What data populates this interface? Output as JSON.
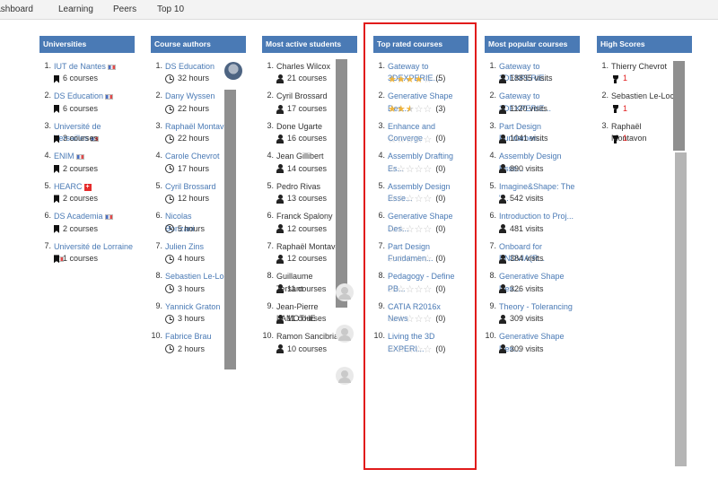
{
  "nav": {
    "tabs": [
      "Dashboard",
      "Learning",
      "Peers",
      "Top 10"
    ]
  },
  "universities": {
    "title": "Universities",
    "items": [
      {
        "name": "IUT de Nantes",
        "flag": "fr",
        "count": "6 courses"
      },
      {
        "name": "DS Education",
        "flag": "fr",
        "count": "6 courses"
      },
      {
        "name": "Université de Versailles",
        "flag": "fr",
        "count": "3 courses"
      },
      {
        "name": "ENIM",
        "flag": "fr",
        "count": "2 courses"
      },
      {
        "name": "HEARC",
        "flag": "ch",
        "count": "2 courses"
      },
      {
        "name": "DS Academia",
        "flag": "fr",
        "count": "2 courses"
      },
      {
        "name": "Université de Lorraine",
        "flag": "fr",
        "count": "1 courses"
      }
    ]
  },
  "authors": {
    "title": "Course authors",
    "items": [
      {
        "name": "DS Education",
        "hours": "32 hours"
      },
      {
        "name": "Dany Wyssen",
        "hours": "22 hours"
      },
      {
        "name": "Raphaël Montavon",
        "hours": "22 hours"
      },
      {
        "name": "Carole Chevrot",
        "hours": "17 hours"
      },
      {
        "name": "Cyril Brossard",
        "hours": "12 hours"
      },
      {
        "name": "Nicolas Bonzani",
        "hours": "5 hours"
      },
      {
        "name": "Julien Zins",
        "hours": "4 hours"
      },
      {
        "name": "Sebastien Le-Loch",
        "hours": "3 hours"
      },
      {
        "name": "Yannick Graton",
        "hours": "3 hours"
      },
      {
        "name": "Fabrice Brau",
        "hours": "2 hours"
      }
    ]
  },
  "students": {
    "title": "Most active students",
    "items": [
      {
        "name": "Charles Wilcox",
        "count": "21 courses"
      },
      {
        "name": "Cyril Brossard",
        "count": "17 courses"
      },
      {
        "name": "Done Ugarte",
        "count": "16 courses"
      },
      {
        "name": "Jean Gillibert",
        "count": "14 courses"
      },
      {
        "name": "Pedro Rivas",
        "count": "13 courses"
      },
      {
        "name": "Franck Spalony",
        "count": "12 courses"
      },
      {
        "name": "Raphaël Montavon",
        "count": "12 courses"
      },
      {
        "name": "Guillaume Tersant",
        "count": "11 courses"
      },
      {
        "name": "Jean-Pierre LAMOTHE",
        "count": "11 courses"
      },
      {
        "name": "Ramon Sancibrian",
        "count": "10 courses"
      }
    ]
  },
  "top_rated": {
    "title": "Top rated courses",
    "items": [
      {
        "name": "Gateway to 3DEXPERIE...",
        "rating": 4,
        "count": "(5)"
      },
      {
        "name": "Generative Shape Des...",
        "rating": 2.5,
        "count": "(3)"
      },
      {
        "name": "Enhance and Converge",
        "rating": 0,
        "count": "(0)"
      },
      {
        "name": "Assembly Drafting Es...",
        "rating": 0,
        "count": "(0)"
      },
      {
        "name": "Assembly Design Esse...",
        "rating": 0,
        "count": "(0)"
      },
      {
        "name": "Generative Shape Des...",
        "rating": 0,
        "count": "(0)"
      },
      {
        "name": "Part Design Fundamen...",
        "rating": 0,
        "count": "(0)"
      },
      {
        "name": "Pedagogy - Define PB...",
        "rating": 0,
        "count": "(0)"
      },
      {
        "name": "CATIA R2016x News",
        "rating": 0,
        "count": "(0)"
      },
      {
        "name": "Living the 3D EXPERI...",
        "rating": 0,
        "count": "(0)"
      }
    ]
  },
  "popular": {
    "title": "Most popular courses",
    "items": [
      {
        "name": "Gateway to 3DEXPERIE...",
        "visits": "18835 visits"
      },
      {
        "name": "Gateway to 3DEXPERIE...",
        "visits": "1120 visits"
      },
      {
        "name": "Part Design Fundamen...",
        "visits": "1041 visits"
      },
      {
        "name": "Assembly Design Esse...",
        "visits": "890 visits"
      },
      {
        "name": "Imagine&Shape: The \"...",
        "visits": "542 visits"
      },
      {
        "name": "Introduction to Proj...",
        "visits": "481 visits"
      },
      {
        "name": "Onboard for ENOVIA(R...",
        "visits": "384 visits"
      },
      {
        "name": "Generative Shape Des...",
        "visits": "326 visits"
      },
      {
        "name": "Theory - Tolerancing",
        "visits": "309 visits"
      },
      {
        "name": "Generative Shape Des...",
        "visits": "309 visits"
      }
    ]
  },
  "scores": {
    "title": "High Scores",
    "items": [
      {
        "name": "Thierry Chevrot",
        "score": "1"
      },
      {
        "name": "Sebastien Le-Loch",
        "score": "1"
      },
      {
        "name": "Raphaël Montavon",
        "score": "1"
      }
    ]
  },
  "colors": {
    "header": "#4a7ab5",
    "link": "#4a7ab5",
    "highlight": "#e11b1b",
    "star": "#f0b43c"
  }
}
